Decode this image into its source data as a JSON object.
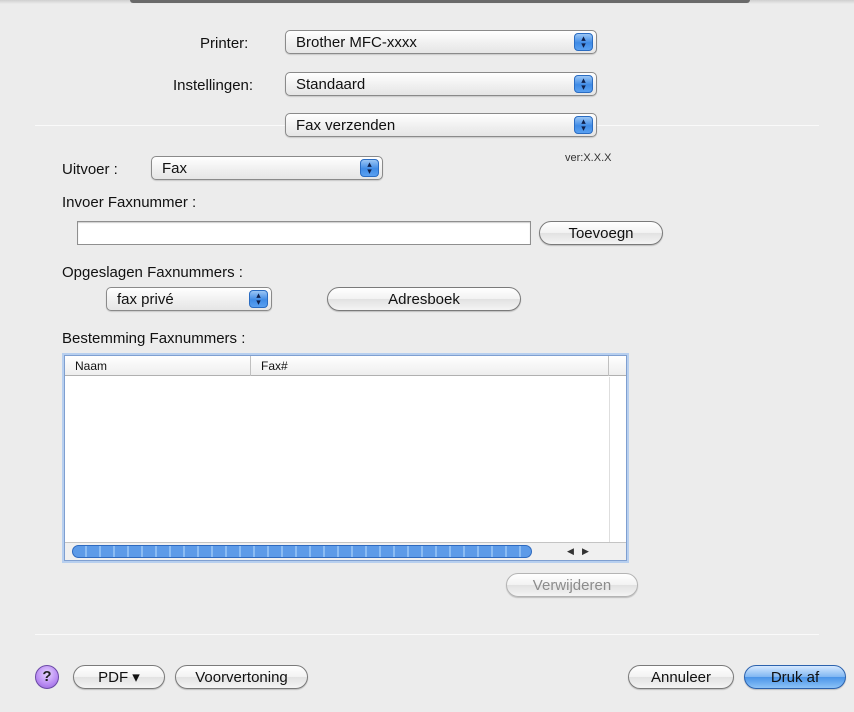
{
  "printer": {
    "label": "Printer:",
    "value": "Brother MFC-xxxx"
  },
  "presets": {
    "label": "Instellingen:",
    "value": "Standaard"
  },
  "panel": {
    "value": "Fax verzenden"
  },
  "output": {
    "label": "Uitvoer :",
    "value": "Fax",
    "version": "ver:X.X.X"
  },
  "fax_input": {
    "label": "Invoer Faxnummer :",
    "value": "",
    "add_button": "Toevoegn"
  },
  "saved": {
    "label": "Opgeslagen Faxnummers :",
    "value": "fax privé",
    "addressbook_button": "Adresboek"
  },
  "destination": {
    "label": "Bestemming Faxnummers :",
    "columns": [
      "Naam",
      "Fax#"
    ],
    "rows": [],
    "delete_button": "Verwijderen"
  },
  "footer": {
    "help": "?",
    "pdf_button": "PDF ▾",
    "preview_button": "Voorvertoning",
    "cancel_button": "Annuleer",
    "print_button": "Druk af"
  },
  "icons": [
    "popup-arrows-icon",
    "help-icon",
    "scroll-left-icon",
    "scroll-right-icon"
  ]
}
